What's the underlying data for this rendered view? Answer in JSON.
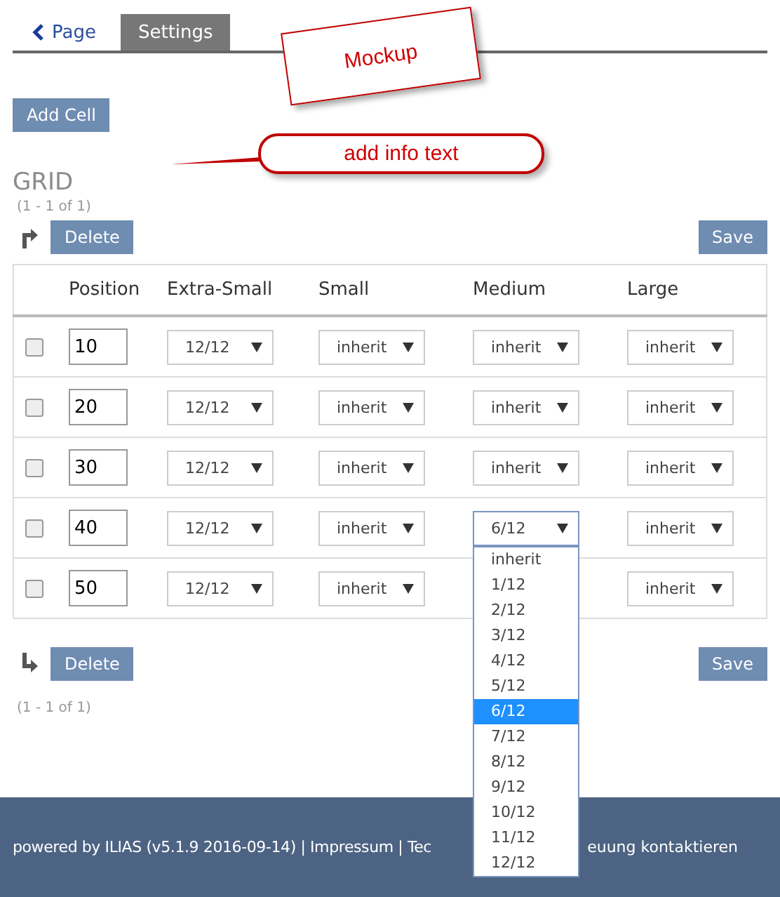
{
  "tabs": [
    {
      "label": "Page",
      "kind": "back",
      "selected": false
    },
    {
      "label": "Settings",
      "kind": "tab",
      "selected": true
    }
  ],
  "annotations": [
    {
      "kind": "sticky-note",
      "text": "Mockup"
    },
    {
      "kind": "callout",
      "text": "add info text"
    }
  ],
  "add_button": "Add Cell",
  "grid": {
    "title": "GRID",
    "range_top": "(1 - 1 of 1)",
    "top_bar": {
      "delete_button": "Delete",
      "save_button": "Save"
    },
    "columns": [
      "Position",
      "Extra-Small",
      "Small",
      "Medium",
      "Large"
    ],
    "rows": [
      {
        "checked": false,
        "cells": [
          {
            "kind": "input",
            "value": "10"
          },
          {
            "kind": "select",
            "value": "12/12",
            "open": false
          },
          {
            "kind": "select",
            "value": "inherit",
            "open": false
          },
          {
            "kind": "select",
            "value": "inherit",
            "open": false
          },
          {
            "kind": "select",
            "value": "inherit",
            "open": false
          }
        ]
      },
      {
        "checked": false,
        "cells": [
          {
            "kind": "input",
            "value": "20"
          },
          {
            "kind": "select",
            "value": "12/12",
            "open": false
          },
          {
            "kind": "select",
            "value": "inherit",
            "open": false
          },
          {
            "kind": "select",
            "value": "inherit",
            "open": false
          },
          {
            "kind": "select",
            "value": "inherit",
            "open": false
          }
        ]
      },
      {
        "checked": false,
        "cells": [
          {
            "kind": "input",
            "value": "30"
          },
          {
            "kind": "select",
            "value": "12/12",
            "open": false
          },
          {
            "kind": "select",
            "value": "inherit",
            "open": false
          },
          {
            "kind": "select",
            "value": "inherit",
            "open": false
          },
          {
            "kind": "select",
            "value": "inherit",
            "open": false
          }
        ]
      },
      {
        "checked": false,
        "cells": [
          {
            "kind": "input",
            "value": "40"
          },
          {
            "kind": "select",
            "value": "12/12",
            "open": false
          },
          {
            "kind": "select",
            "value": "inherit",
            "open": false
          },
          {
            "kind": "select",
            "value": "6/12",
            "open": true,
            "options": [
              {
                "label": "inherit",
                "selected": false
              },
              {
                "label": "1/12",
                "selected": false
              },
              {
                "label": "2/12",
                "selected": false
              },
              {
                "label": "3/12",
                "selected": false
              },
              {
                "label": "4/12",
                "selected": false
              },
              {
                "label": "5/12",
                "selected": false
              },
              {
                "label": "6/12",
                "selected": true
              },
              {
                "label": "7/12",
                "selected": false
              },
              {
                "label": "8/12",
                "selected": false
              },
              {
                "label": "9/12",
                "selected": false
              },
              {
                "label": "10/12",
                "selected": false
              },
              {
                "label": "11/12",
                "selected": false
              },
              {
                "label": "12/12",
                "selected": false
              }
            ]
          },
          {
            "kind": "select",
            "value": "inherit",
            "open": false
          }
        ]
      },
      {
        "checked": false,
        "cells": [
          {
            "kind": "input",
            "value": "50"
          },
          {
            "kind": "select",
            "value": "12/12",
            "open": false
          },
          {
            "kind": "select",
            "value": "inherit",
            "open": false
          },
          {
            "kind": "covered"
          },
          {
            "kind": "select",
            "value": "inherit",
            "open": false
          }
        ]
      }
    ],
    "bottom_bar": {
      "delete_button": "Delete",
      "save_button": "Save"
    },
    "range_bottom": "(1 - 1 of 1)"
  },
  "footer": {
    "text_before": "powered by ILIAS (v5.1.9 2016-09-14) | Impressum | Tec",
    "text_after": "euung kontaktieren"
  }
}
